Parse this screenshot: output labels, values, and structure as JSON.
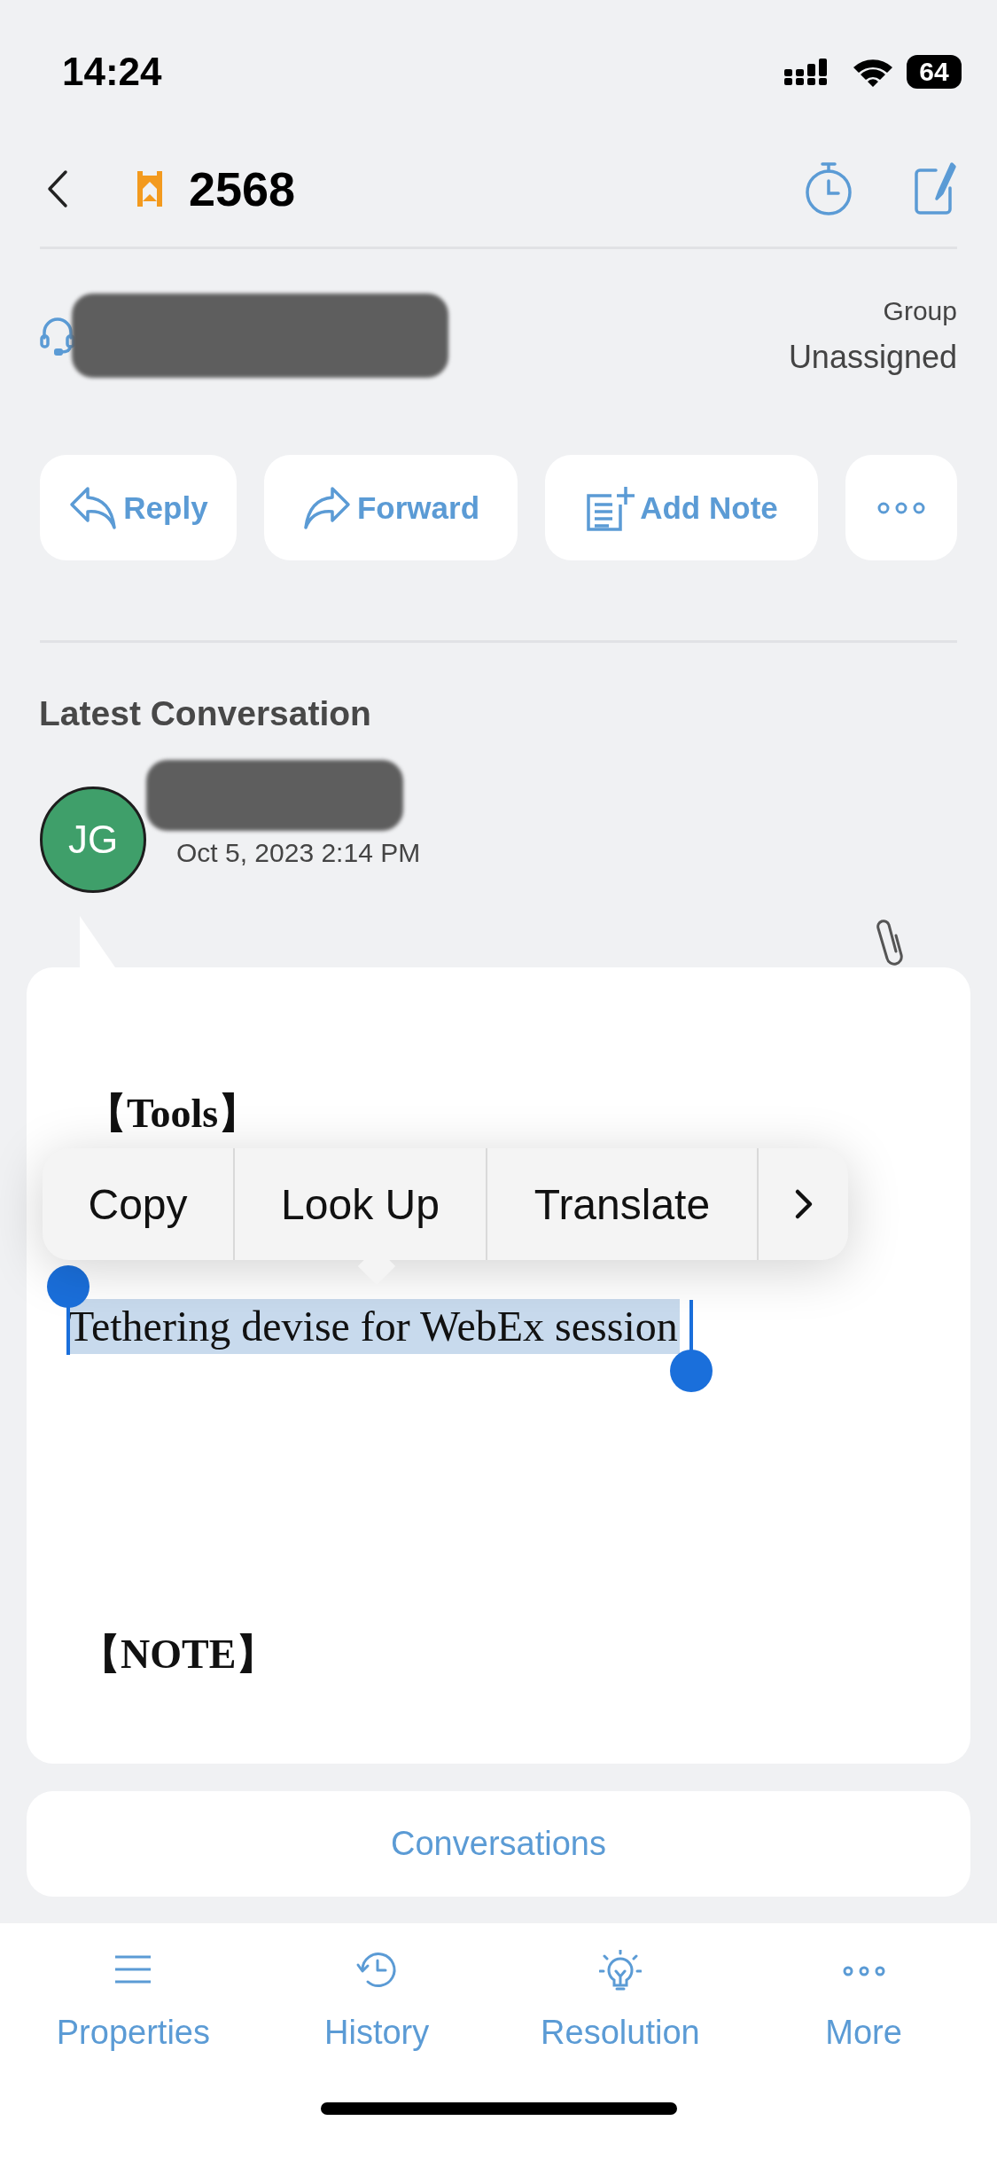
{
  "status_bar": {
    "time": "14:24",
    "battery": "64"
  },
  "header": {
    "ticket_number": "2568"
  },
  "requester": {
    "group_label": "Group",
    "group_value": "Unassigned"
  },
  "actions": [
    {
      "kind": "reply",
      "label": "Reply"
    },
    {
      "kind": "forward",
      "label": "Forward"
    },
    {
      "kind": "note",
      "label": "Add Note"
    },
    {
      "kind": "more"
    }
  ],
  "latest_conversation": {
    "heading": "Latest Conversation",
    "avatar_initials": "JG",
    "date": "Oct 5, 2023 2:14 PM",
    "body": [
      {
        "kind": "heading",
        "text": "【Tools】",
        "selected": false
      },
      {
        "kind": "text",
        "text": "Tethering devise for WebEx session",
        "selected": true
      },
      {
        "kind": "heading",
        "text": "【NOTE】",
        "selected": false
      }
    ]
  },
  "context_menu": {
    "items": [
      "Copy",
      "Look Up",
      "Translate"
    ]
  },
  "conversations_button": "Conversations",
  "tab_bar": [
    {
      "kind": "properties",
      "label": "Properties"
    },
    {
      "kind": "history",
      "label": "History"
    },
    {
      "kind": "resolution",
      "label": "Resolution"
    },
    {
      "kind": "more",
      "label": "More"
    }
  ]
}
